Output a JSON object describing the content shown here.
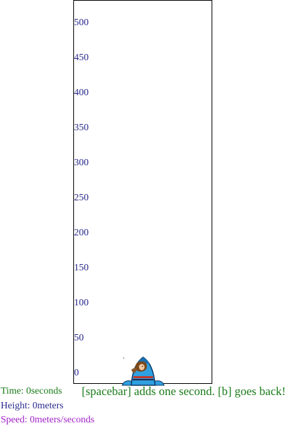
{
  "scale": {
    "ticks": [
      "500",
      "450",
      "400",
      "350",
      "300",
      "250",
      "200",
      "150",
      "100",
      "50",
      "0"
    ],
    "color": "#2a2a8e"
  },
  "rocket": {
    "icon": "rocket-with-pilot-icon",
    "body_color": "#2fa0e0"
  },
  "status": {
    "time_label": "Time: ",
    "time_value": "0",
    "time_unit": "seconds",
    "time_color": "#1a7a1a",
    "height_label": "Height: ",
    "height_value": "0",
    "height_unit": "meters",
    "height_color": "#2a2a8e",
    "speed_label": "Speed: ",
    "speed_value": "0",
    "speed_unit": "meters/seconds",
    "speed_color": "#a020c8"
  },
  "instructions": {
    "text": "[spacebar] adds one second.  [b] goes back!",
    "color": "#1a7a1a"
  }
}
